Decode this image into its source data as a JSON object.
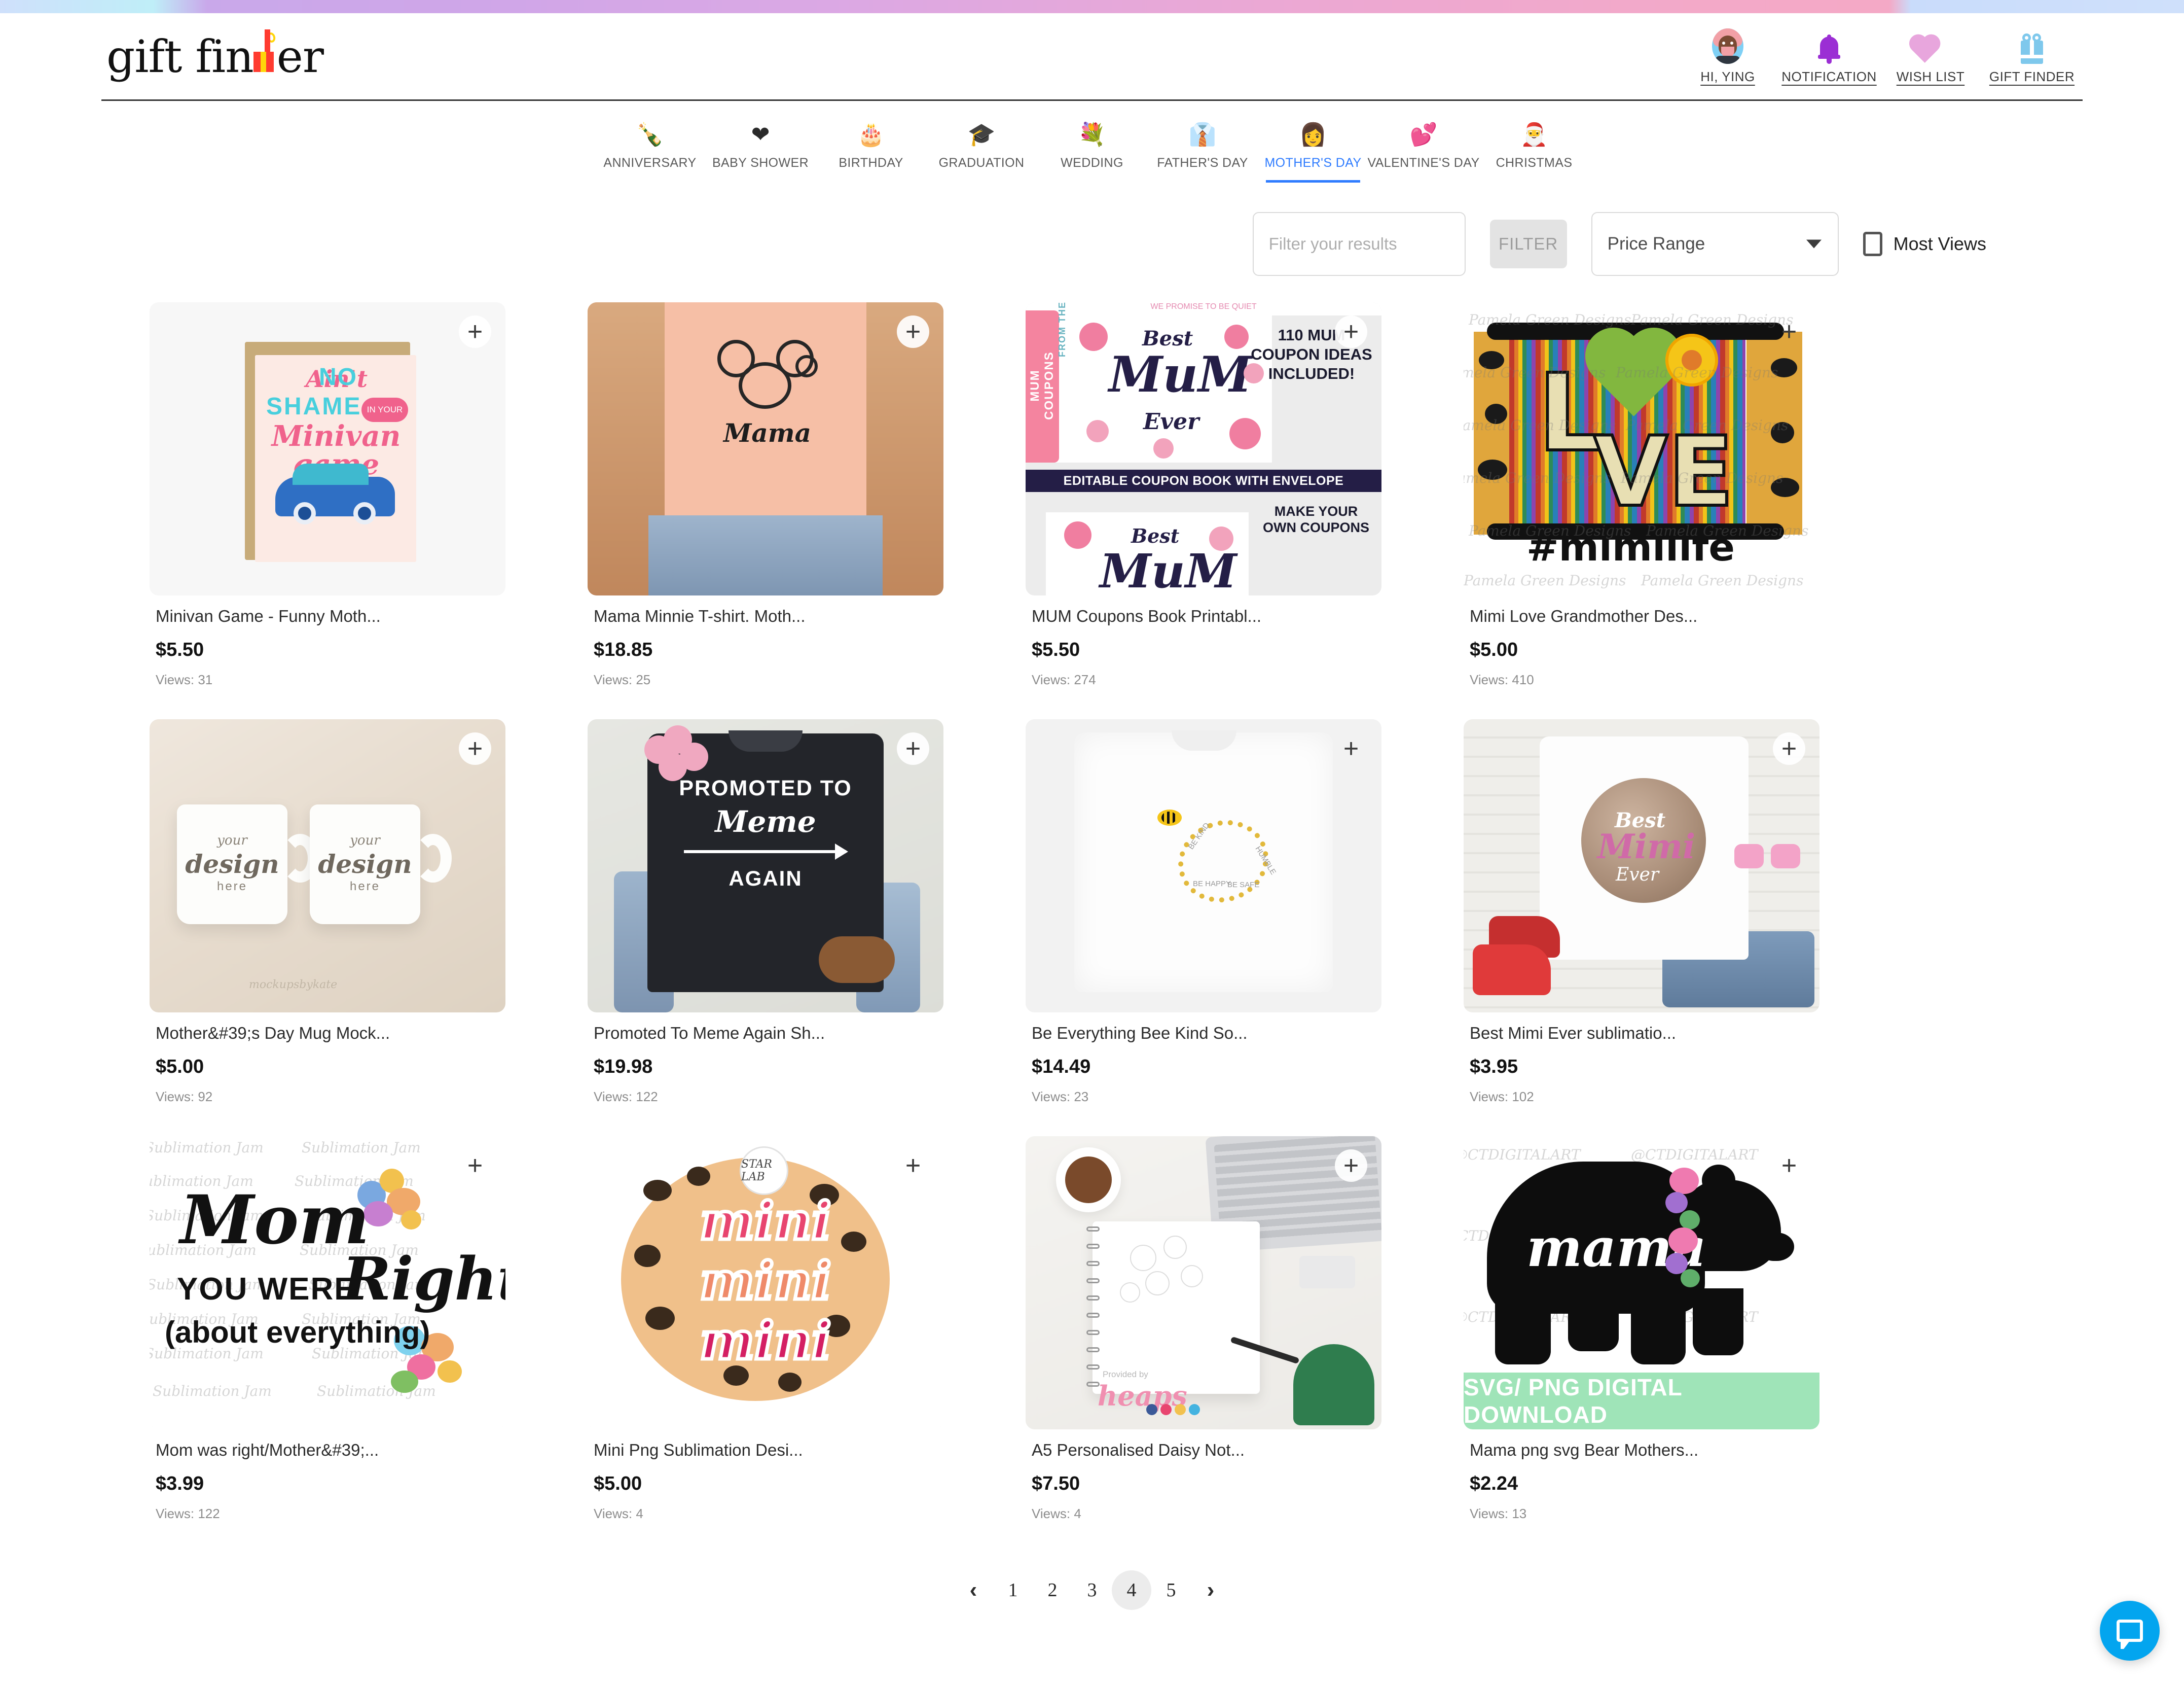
{
  "brand": {
    "name": "gift finder",
    "logo_text_1": "gift fin",
    "logo_text_2": "er"
  },
  "header": {
    "actions": [
      {
        "label": "HI, YING",
        "icon": "avatar-icon"
      },
      {
        "label": "NOTIFICATION",
        "icon": "bell-icon"
      },
      {
        "label": "WISH LIST",
        "icon": "heart-icon"
      },
      {
        "label": "GIFT FINDER",
        "icon": "gift-box-icon"
      }
    ]
  },
  "categories": [
    {
      "label": "ANNIVERSARY",
      "icon": "champagne-icon",
      "active": false
    },
    {
      "label": "BABY SHOWER",
      "icon": "heart-icon",
      "active": false
    },
    {
      "label": "BIRTHDAY",
      "icon": "cake-icon",
      "active": false
    },
    {
      "label": "GRADUATION",
      "icon": "diploma-icon",
      "active": false
    },
    {
      "label": "WEDDING",
      "icon": "rings-icon",
      "active": false
    },
    {
      "label": "FATHER'S DAY",
      "icon": "tie-icon",
      "active": false
    },
    {
      "label": "MOTHER'S DAY",
      "icon": "woman-icon",
      "active": true
    },
    {
      "label": "VALENTINE'S DAY",
      "icon": "love-birds-icon",
      "active": false
    },
    {
      "label": "CHRISTMAS",
      "icon": "stocking-icon",
      "active": false
    }
  ],
  "filters": {
    "search_placeholder": "Filter your results",
    "search_value": "",
    "filter_button": "FILTER",
    "price_range_label": "Price Range",
    "most_views_label": "Most Views",
    "most_views_checked": false
  },
  "accent_color": "#2f7cff",
  "add_icon": "plus-icon",
  "products": [
    {
      "title": "Minivan Game - Funny Moth...",
      "price": "$5.50",
      "views": "Views: 31",
      "art": "a1",
      "alt": "greeting card Ain't No Shame In Your Minivan Game"
    },
    {
      "title": "Mama Minnie T-shirt. Moth...",
      "price": "$18.85",
      "views": "Views: 25",
      "art": "a2",
      "alt": "peach t-shirt with Mama Minnie design"
    },
    {
      "title": "MUM Coupons Book Printabl...",
      "price": "$5.50",
      "views": "Views: 274",
      "art": "a3",
      "alt": "Best Mum Ever editable coupon book"
    },
    {
      "title": "Mimi Love Grandmother Des...",
      "price": "$5.00",
      "views": "Views: 410",
      "art": "a4",
      "alt": "LOVE cactus serape #mimilife design"
    },
    {
      "title": "Mother&#39;s Day Mug Mock...",
      "price": "$5.00",
      "views": "Views: 92",
      "art": "a5",
      "alt": "two white mug mockups on cream fabric"
    },
    {
      "title": "Promoted To Meme Again Sh...",
      "price": "$19.98",
      "views": "Views: 122",
      "art": "a6",
      "alt": "black t-shirt Promoted To Meme Again"
    },
    {
      "title": "Be Everything Bee Kind So...",
      "price": "$14.49",
      "views": "Views: 23",
      "art": "a7",
      "alt": "white t-shirt with bee heart design"
    },
    {
      "title": "Best Mimi Ever sublimatio...",
      "price": "$3.95",
      "views": "Views: 102",
      "art": "a8",
      "alt": "Best Mimi Ever youth tee flat lay"
    },
    {
      "title": "Mom was right/Mother&#39;...",
      "price": "$3.99",
      "views": "Views: 122",
      "art": "a9",
      "alt": "Mom You Were Right about everything floral design"
    },
    {
      "title": "Mini Png Sublimation Desi...",
      "price": "$5.00",
      "views": "Views: 4",
      "art": "a10",
      "alt": "mini mini mini leopard print sublimation"
    },
    {
      "title": "A5 Personalised Daisy Not...",
      "price": "$7.50",
      "views": "Views: 4",
      "art": "a11",
      "alt": "daisy notebook flat lay with laptop and coffee"
    },
    {
      "title": "Mama png svg Bear Mothers...",
      "price": "$2.24",
      "views": "Views: 13",
      "art": "a12",
      "alt": "mama bear silhouette with flowers"
    }
  ],
  "art_text": {
    "card1": {
      "l1": "Ain't",
      "l2": "NO",
      "l3": "SHAME",
      "pill": "IN YOUR",
      "l4": "Minivan game"
    },
    "card2": {
      "mama": "Mama"
    },
    "card3": {
      "top_note": "WE PROMISE TO BE QUIET",
      "ticket": "MUM COUPONS",
      "from_kids": "FROM THE KIDS",
      "best": "Best",
      "mum": "MuM",
      "ever": "Ever",
      "bar": "EDITABLE COUPON BOOK WITH ENVELOPE",
      "right1": "110 MUM COUPON IDEAS INCLUDED!",
      "right2": "MAKE YOUR OWN COUPONS"
    },
    "card4": {
      "love_l": "L",
      "love_ve": "VE",
      "hashtag": "#mimilife",
      "watermark": "Pamela Green Designs"
    },
    "card5": {
      "your": "your",
      "design": "design",
      "here": "here",
      "signature": "mockupsbykate"
    },
    "card6": {
      "l1": "PROMOTED TO",
      "l2": "Meme",
      "l3": "AGAIN"
    },
    "card7": {
      "w1": "BE KIND",
      "w2": "BE HAPPY",
      "w3": "BE SAFE",
      "w4": "HUMBLE"
    },
    "card8": {
      "best": "Best",
      "mimi": "Mimi",
      "ever": "Ever"
    },
    "card9": {
      "mom": "Mom",
      "l2": "YOU WERE",
      "right": "Right",
      "l3": "(about everything)",
      "watermark": "Sublimation Jam"
    },
    "card10": {
      "m1": "mini",
      "m2": "mini",
      "m3": "mini",
      "badge": "STAR LAB"
    },
    "card11": {
      "heaps": "heaps",
      "provided": "Provided by"
    },
    "card12": {
      "mama": "mama",
      "banner": "SVG/ PNG DIGITAL DOWNLOAD",
      "watermark": "@CTDIGITALART"
    }
  },
  "pagination": {
    "prev": "‹",
    "pages": [
      "1",
      "2",
      "3",
      "4",
      "5"
    ],
    "current": "4",
    "next": "›"
  },
  "chat": {
    "icon": "chat-bubble-icon",
    "color": "#03a5ef"
  }
}
